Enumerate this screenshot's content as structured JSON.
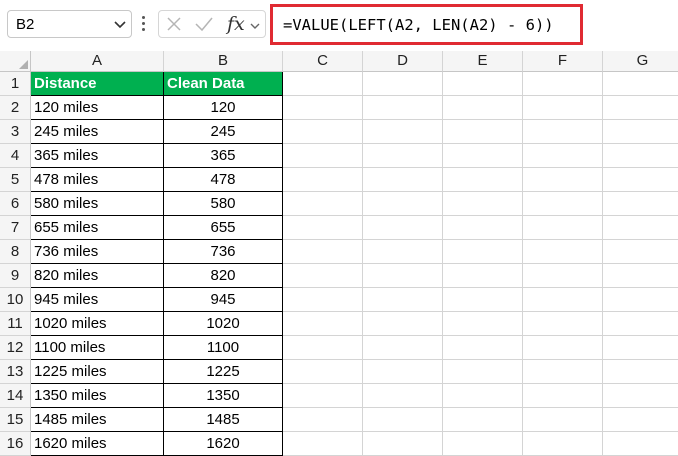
{
  "formula_bar": {
    "name_box": "B2",
    "fx_label": "fx",
    "formula": "=VALUE(LEFT(A2, LEN(A2) - 6))"
  },
  "columns": [
    "A",
    "B",
    "C",
    "D",
    "E",
    "F",
    "G"
  ],
  "rows": [
    "1",
    "2",
    "3",
    "4",
    "5",
    "6",
    "7",
    "8",
    "9",
    "10",
    "11",
    "12",
    "13",
    "14",
    "15",
    "16"
  ],
  "table": {
    "headers": [
      "Distance",
      "Clean Data"
    ],
    "distance": [
      "120 miles",
      "245 miles",
      "365 miles",
      "478 miles",
      "580 miles",
      "655 miles",
      "736 miles",
      "820 miles",
      "945 miles",
      "1020 miles",
      "1100 miles",
      "1225 miles",
      "1350 miles",
      "1485 miles",
      "1620 miles"
    ],
    "clean": [
      "120",
      "245",
      "365",
      "478",
      "580",
      "655",
      "736",
      "820",
      "945",
      "1020",
      "1100",
      "1225",
      "1350",
      "1485",
      "1620"
    ]
  },
  "colors": {
    "header_fill": "#00b050",
    "highlight_border": "#e02a32"
  }
}
